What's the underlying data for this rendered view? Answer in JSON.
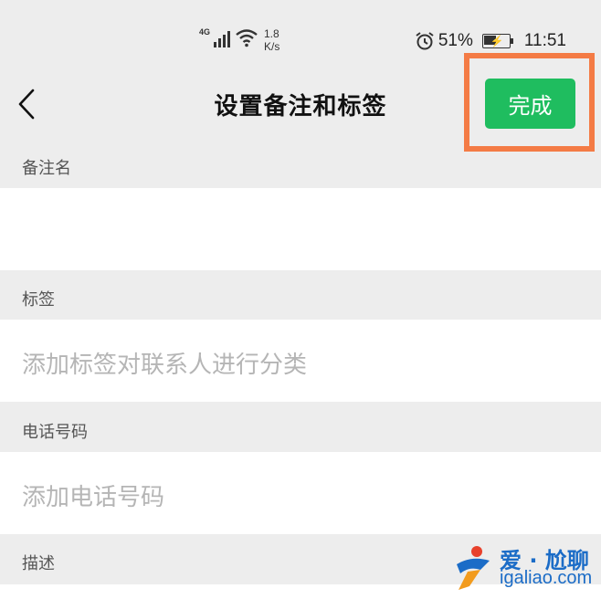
{
  "status_bar": {
    "network": "4G",
    "speed_value": "1.8",
    "speed_unit": "K/s",
    "battery": "51%",
    "battery_level": 0.51,
    "time": "11:51"
  },
  "nav": {
    "back_icon": "chevron-left-icon",
    "title": "设置备注和标签",
    "done_label": "完成"
  },
  "form": {
    "remark_label": "备注名",
    "remark_value": "",
    "tag_label": "标签",
    "tag_placeholder": "添加标签对联系人进行分类",
    "phone_label": "电话号码",
    "phone_placeholder": "添加电话号码",
    "desc_label": "描述"
  },
  "watermark": {
    "text": "爱 · 尬聊",
    "url": "igaliao.com"
  },
  "colors": {
    "accent": "#1fbd5f",
    "highlight": "#f47b45",
    "background": "#ededed"
  }
}
